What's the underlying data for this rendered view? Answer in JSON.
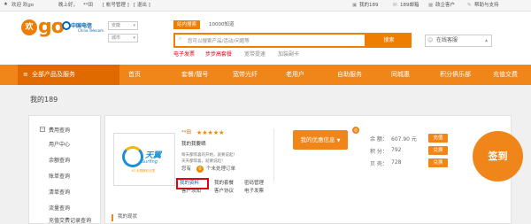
{
  "topbar": {
    "welcome": "欢迎 欢go",
    "greeting": "晚上好，",
    "user": "**田",
    "account_mgmt": "[ 帐号管理 ]",
    "logout": "[ 退出 ]",
    "my189": "我的189",
    "mail": "189邮箱",
    "enterprise": "政企客户",
    "help": "帮助与支持"
  },
  "header": {
    "logo_huan": "欢",
    "logo_go": "go",
    "telecom_name": "中国电信",
    "telecom_sub": "China Telecom",
    "province": "安徽",
    "city": "城市",
    "search_tabs": [
      "站内搜索",
      "10000知道"
    ],
    "search_placeholder": "您可以搜索产品/活动/问题等",
    "search_button": "搜索",
    "hot_links": [
      "电子发票",
      "步步高套餐",
      "宽带提速",
      "加装副卡"
    ],
    "online_service": "在线客服"
  },
  "nav": {
    "all_products": "全部产品及服务",
    "items": [
      "首页",
      "套餐/靓号",
      "宽带光纤",
      "老用户",
      "自助服务",
      "同城惠",
      "积分俱乐部",
      "充值交费"
    ]
  },
  "page_title": "我的189",
  "left_menu": {
    "group": "费用查询",
    "items": [
      "用户中心",
      "余额查询",
      "账单查询",
      "清单查询",
      "流量查询",
      "充值交费记录查询"
    ]
  },
  "profile": {
    "name": "**田",
    "rating_stars": 5,
    "my_welfare": "我的我要晒",
    "notice": "每天都惊喜的开始，就要说起！",
    "notice2": "天天都惊喜，就要说起！",
    "pending_prefix": "您有",
    "pending_count": "0",
    "pending_suffix": "个未处理订单",
    "links_row1": [
      "我的资料",
      "我的套餐",
      "密码管理"
    ],
    "links_row2": [
      "客户须知",
      "客户协议",
      "电子发票"
    ]
  },
  "logo_badge": {
    "tianyi": "天翼",
    "surfing": "Surfing",
    "tag": "3G 无限精彩无限"
  },
  "offers": {
    "label": "我的优惠信息",
    "count": "0"
  },
  "account": {
    "balance_label": "余  额：",
    "balance": "607.90 元",
    "balance_btn": "充值",
    "points_label": "积  分：",
    "points": "792",
    "points_btn": "兑换",
    "beans_label": "贝  壳：",
    "beans": "728",
    "beans_btn": "兑换"
  },
  "signin": "签到",
  "status_title": "我的现状",
  "colors": {
    "brand_orange": "#f08519",
    "highlight_red": "#e60012"
  }
}
